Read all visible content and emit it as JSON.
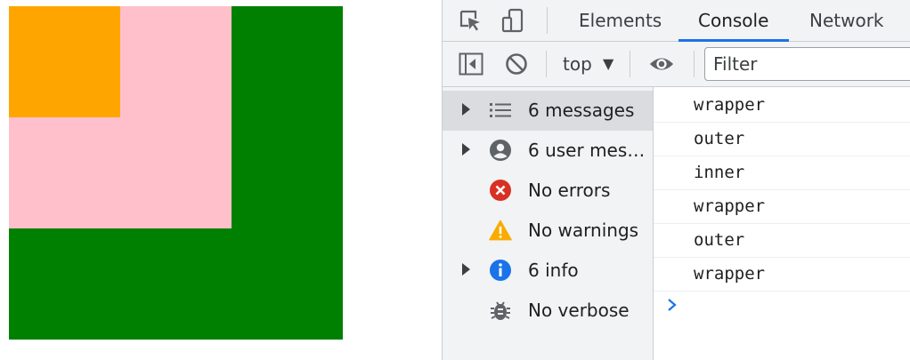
{
  "devtools": {
    "tabs": [
      {
        "label": "Elements"
      },
      {
        "label": "Console"
      },
      {
        "label": "Network"
      }
    ],
    "toolbar": {
      "context": "top",
      "filter_placeholder": "Filter"
    },
    "sidebar": {
      "items": [
        {
          "label": "6 messages",
          "icon": "list-icon"
        },
        {
          "label": "6 user messages",
          "icon": "user-icon"
        },
        {
          "label": "No errors",
          "icon": "error-icon"
        },
        {
          "label": "No warnings",
          "icon": "warning-icon"
        },
        {
          "label": "6 info",
          "icon": "info-icon"
        },
        {
          "label": "No verbose",
          "icon": "bug-icon"
        }
      ]
    },
    "console": {
      "messages": [
        "wrapper",
        "outer",
        "inner",
        "wrapper",
        "outer",
        "wrapper"
      ]
    }
  },
  "demo": {
    "colors": {
      "outer": "#008000",
      "middle": "#ffc0cb",
      "inner": "#ffa500"
    }
  }
}
